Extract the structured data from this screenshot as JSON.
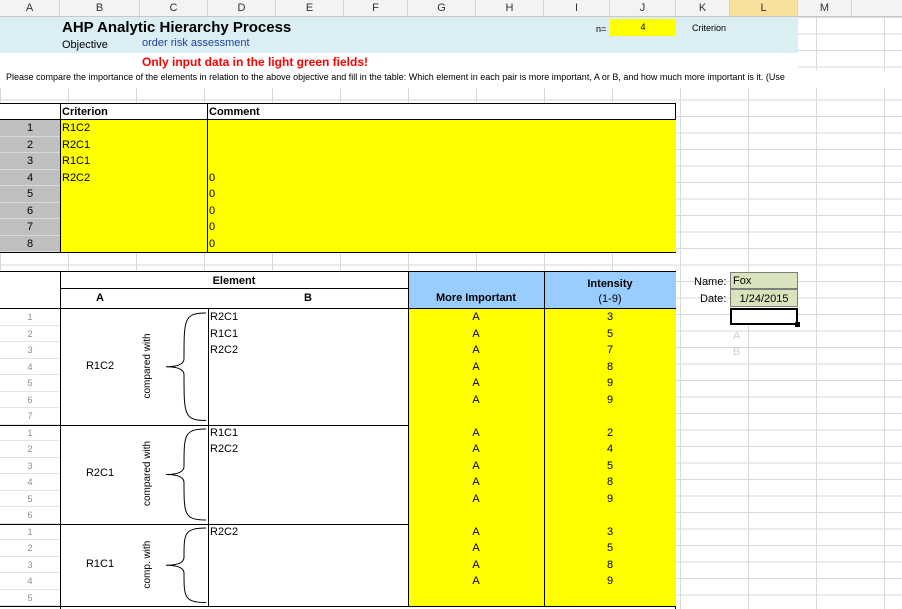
{
  "columns": [
    "A",
    "B",
    "C",
    "D",
    "E",
    "F",
    "G",
    "H",
    "I",
    "J",
    "K",
    "L",
    "M"
  ],
  "title": "AHP Analytic Hierarchy Process",
  "objective_label": "Objective",
  "objective_value": "order risk assessment",
  "n_label": "n=",
  "n_value": "4",
  "criterion_label": "Criterion",
  "warning": "Only input data in the light green fields!",
  "instruction": "Please compare the importance of the elements in relation to the above objective and fill in the table: Which element in each pair is more important, A or B, and how much more important is it. (Use",
  "criteria_table": {
    "header_criterion": "Criterion",
    "header_comment": "Comment",
    "rows": [
      {
        "no": "1",
        "name": "R1C2",
        "comment": ""
      },
      {
        "no": "2",
        "name": "R2C1",
        "comment": ""
      },
      {
        "no": "3",
        "name": "R1C1",
        "comment": ""
      },
      {
        "no": "4",
        "name": "R2C2",
        "comment": "0"
      },
      {
        "no": "5",
        "name": "",
        "comment": "0"
      },
      {
        "no": "6",
        "name": "",
        "comment": "0"
      },
      {
        "no": "7",
        "name": "",
        "comment": "0"
      },
      {
        "no": "8",
        "name": "",
        "comment": "0"
      }
    ]
  },
  "comparison_header": {
    "element": "Element",
    "col_a": "A",
    "col_b": "B",
    "more_important": "More Important",
    "intensity": "Intensity",
    "intensity_range": "(1-9)"
  },
  "name_label": "Name:",
  "name_value": "Fox",
  "date_label": "Date:",
  "date_value": "1/24/2015",
  "faint_list": [
    "A",
    "B"
  ],
  "groups": [
    {
      "a": "R1C2",
      "compared": "compared with",
      "rows": [
        {
          "no": "1",
          "b": "R2C1",
          "more": "A",
          "intensity": "3"
        },
        {
          "no": "2",
          "b": "R1C1",
          "more": "A",
          "intensity": "5"
        },
        {
          "no": "3",
          "b": "R2C2",
          "more": "A",
          "intensity": "7"
        },
        {
          "no": "4",
          "b": "",
          "more": "A",
          "intensity": "8"
        },
        {
          "no": "5",
          "b": "",
          "more": "A",
          "intensity": "9"
        },
        {
          "no": "6",
          "b": "",
          "more": "A",
          "intensity": "9"
        },
        {
          "no": "7",
          "b": "",
          "more": "",
          "intensity": ""
        }
      ]
    },
    {
      "a": "R2C1",
      "compared": "compared with",
      "rows": [
        {
          "no": "1",
          "b": "R1C1",
          "more": "A",
          "intensity": "2"
        },
        {
          "no": "2",
          "b": "R2C2",
          "more": "A",
          "intensity": "4"
        },
        {
          "no": "3",
          "b": "",
          "more": "A",
          "intensity": "5"
        },
        {
          "no": "4",
          "b": "",
          "more": "A",
          "intensity": "8"
        },
        {
          "no": "5",
          "b": "",
          "more": "A",
          "intensity": "9"
        },
        {
          "no": "6",
          "b": "",
          "more": "",
          "intensity": ""
        }
      ]
    },
    {
      "a": "R1C1",
      "compared": "comp. with",
      "rows": [
        {
          "no": "1",
          "b": "R2C2",
          "more": "A",
          "intensity": "3"
        },
        {
          "no": "2",
          "b": "",
          "more": "A",
          "intensity": "5"
        },
        {
          "no": "3",
          "b": "",
          "more": "A",
          "intensity": "8"
        },
        {
          "no": "4",
          "b": "",
          "more": "A",
          "intensity": "9"
        },
        {
          "no": "5",
          "b": "",
          "more": "",
          "intensity": ""
        }
      ]
    }
  ]
}
